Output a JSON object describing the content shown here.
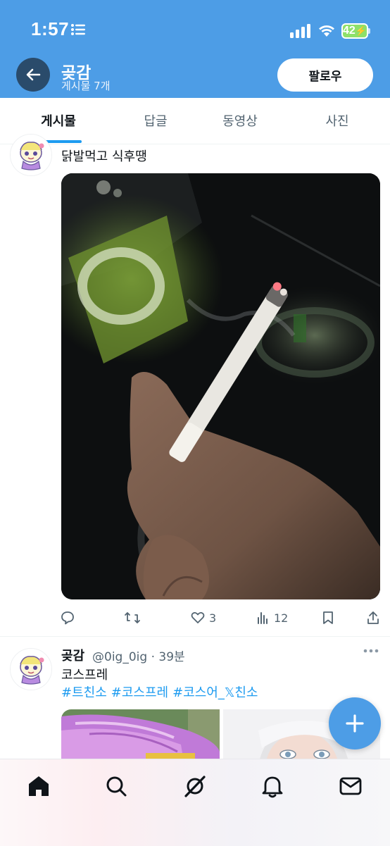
{
  "status_bar": {
    "time": "1:57",
    "battery": "42"
  },
  "header": {
    "back_icon": "arrow-left-icon",
    "profile_name": "곶감",
    "post_count": "게시물 7개",
    "follow_label": "팔로우"
  },
  "tabs": [
    {
      "label": "게시물",
      "active": true
    },
    {
      "label": "답글",
      "active": false
    },
    {
      "label": "동영상",
      "active": false
    },
    {
      "label": "사진",
      "active": false
    }
  ],
  "posts": [
    {
      "text": "닭발먹고 식후땡",
      "image": "hand-holding-cigarette-photo",
      "actions": {
        "reply": "",
        "retweet": "",
        "likes": "3",
        "views": "12"
      }
    },
    {
      "name": "곶감",
      "handle": "@0ig_0ig · 39분",
      "text": "코스프레",
      "hashtags": [
        "#트친소",
        "#코스프레",
        "#코스어_𝕏친소"
      ]
    }
  ],
  "bottom_nav": [
    {
      "icon": "home-icon"
    },
    {
      "icon": "search-icon"
    },
    {
      "icon": "grok-icon"
    },
    {
      "icon": "notifications-icon"
    },
    {
      "icon": "messages-icon"
    }
  ],
  "colors": {
    "header_bg": "#4d9de6",
    "accent": "#1d9bf0",
    "text": "#0f1419",
    "muted": "#536471"
  }
}
